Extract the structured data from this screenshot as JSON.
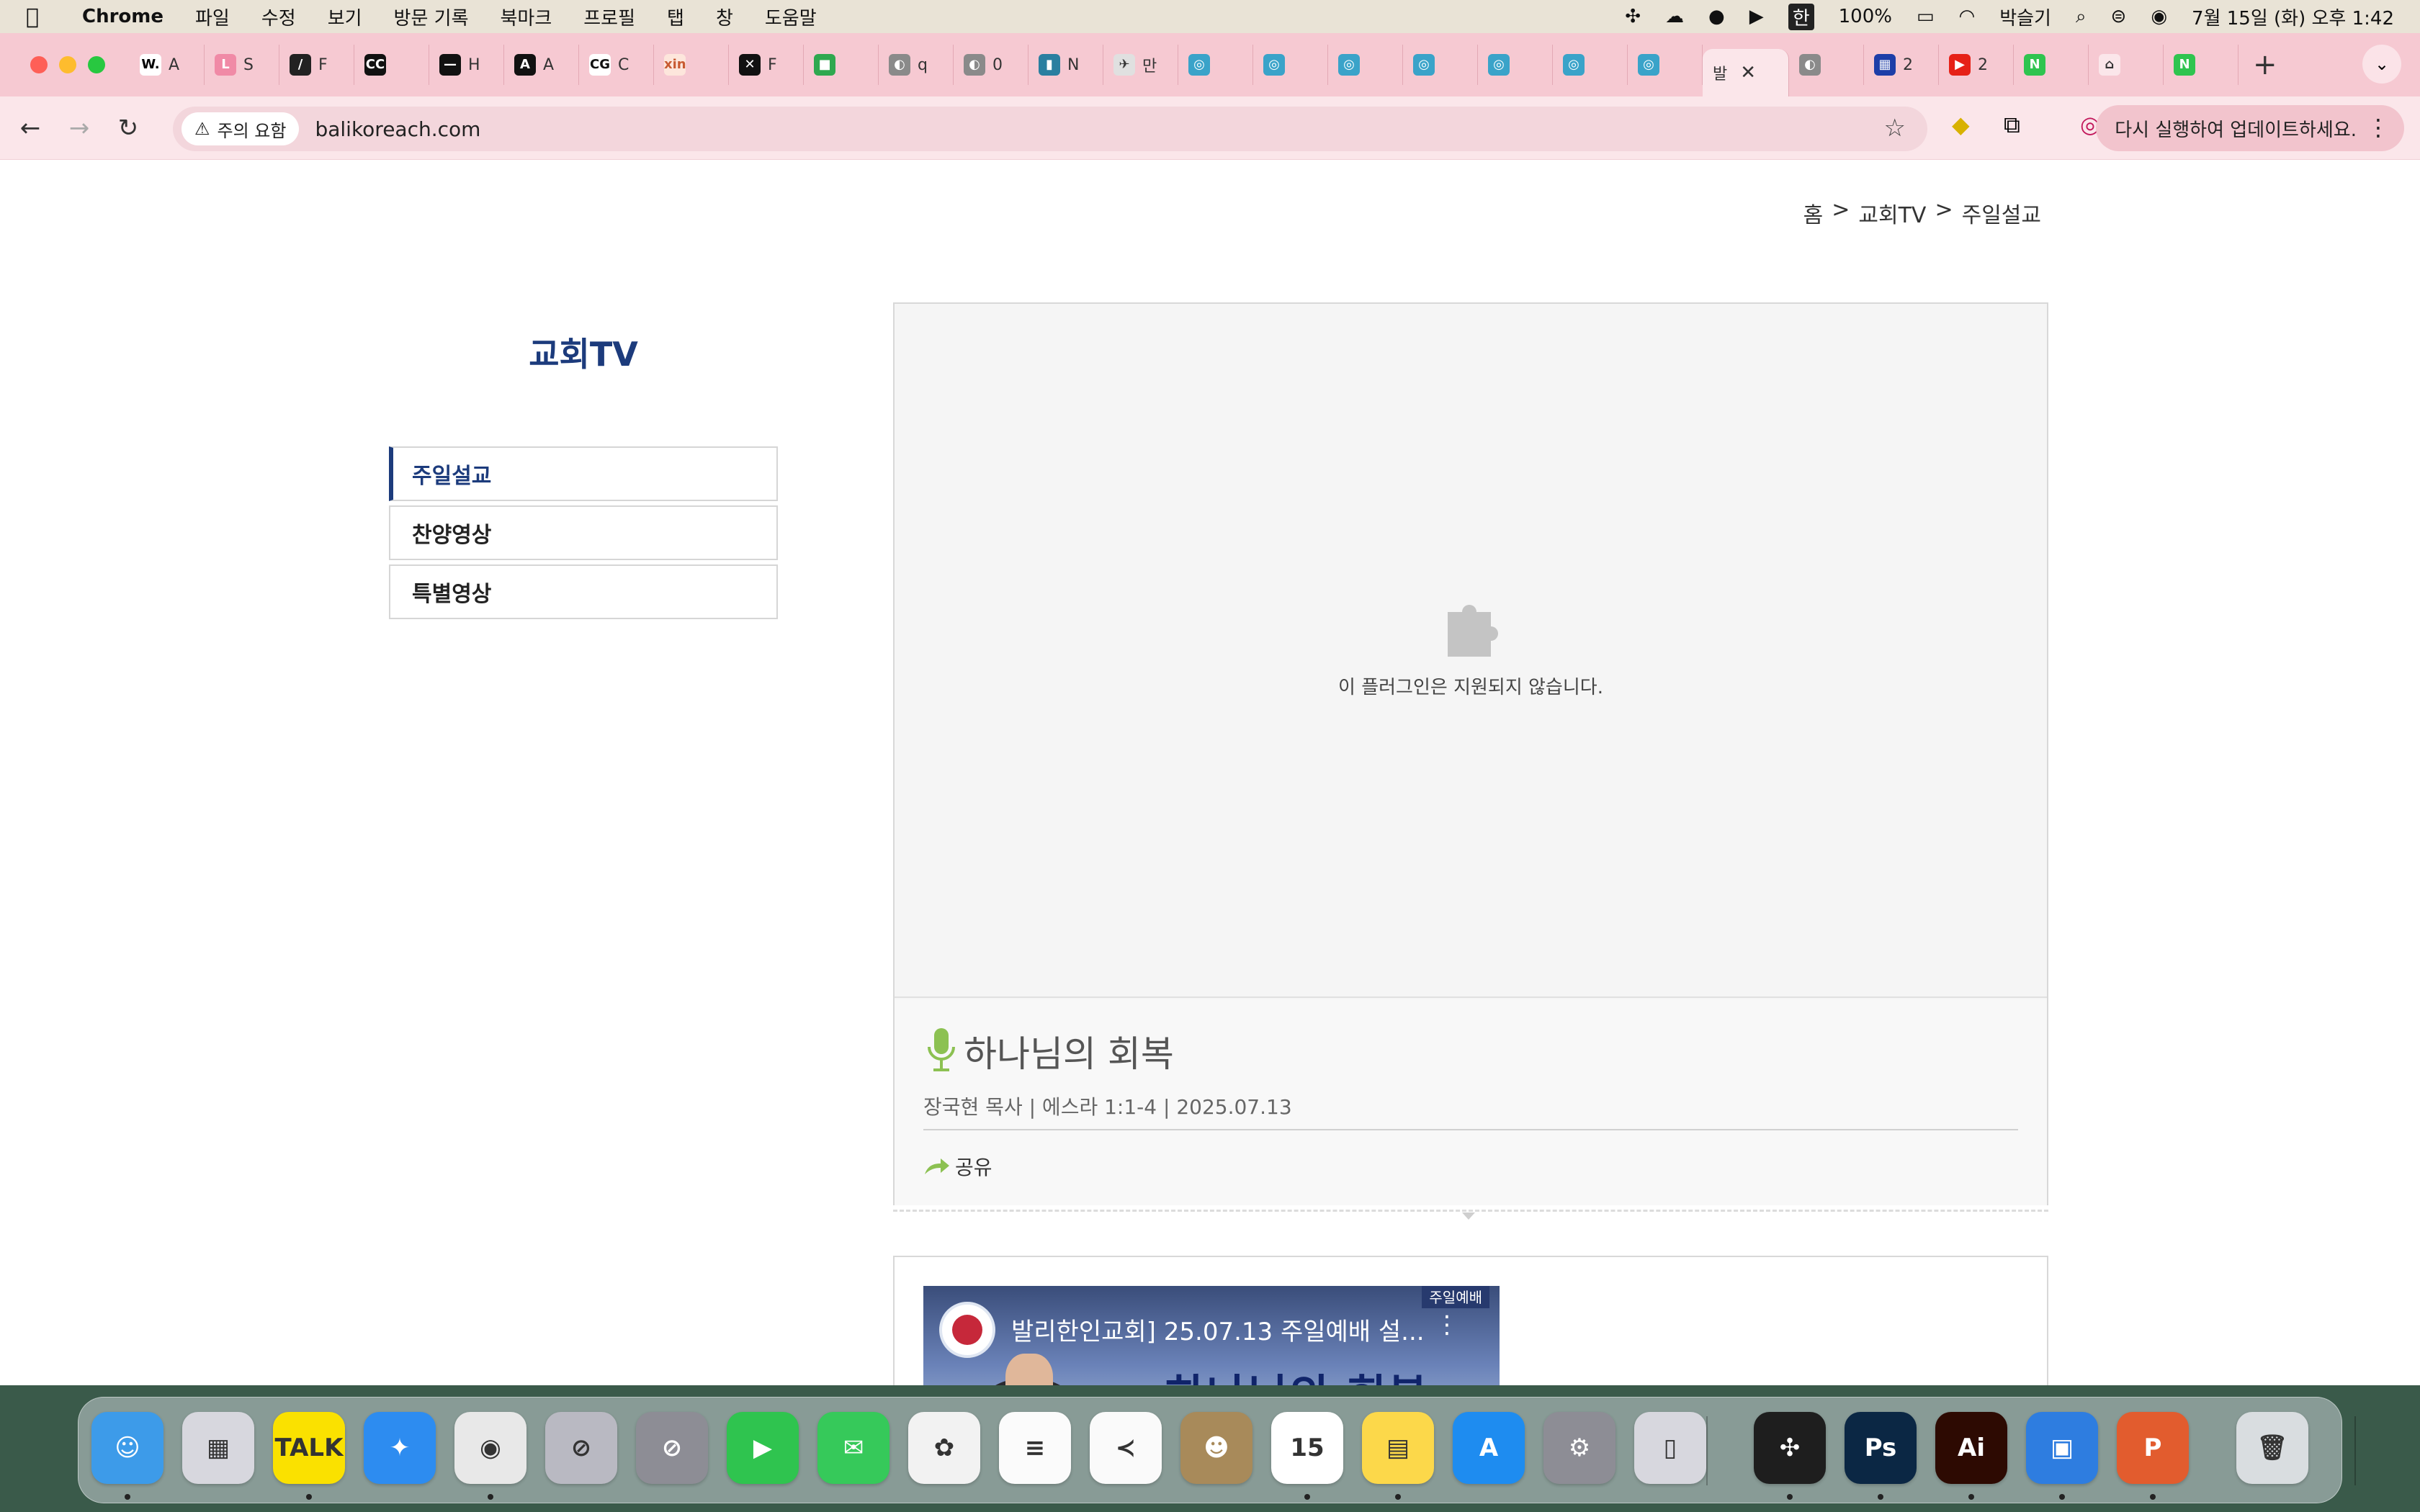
{
  "menubar": {
    "app_name": "Chrome",
    "menus": [
      "파일",
      "수정",
      "보기",
      "방문 기록",
      "북마크",
      "프로필",
      "탭",
      "창",
      "도움말"
    ],
    "battery": "100%",
    "input_lang": "한",
    "user": "박슬기",
    "datetime": "7월 15일 (화) 오후 1:42"
  },
  "tabs": [
    {
      "fav": "W.",
      "label": "A",
      "color": "#ffffff",
      "fg": "#000000"
    },
    {
      "fav": "L",
      "label": "S",
      "color": "#f08aa6",
      "fg": "#ffffff"
    },
    {
      "fav": "/",
      "label": "F",
      "color": "#222222",
      "fg": "#ffffff"
    },
    {
      "fav": "CC",
      "label": "",
      "color": "#111111",
      "fg": "#ffffff"
    },
    {
      "fav": "—",
      "label": "H",
      "color": "#111111",
      "fg": "#ffffff"
    },
    {
      "fav": "A",
      "label": "A",
      "color": "#111111",
      "fg": "#ffffff"
    },
    {
      "fav": "CG",
      "label": "C",
      "color": "#ffffff",
      "fg": "#111111"
    },
    {
      "fav": "xin",
      "label": "",
      "color": "#fde6dc",
      "fg": "#c85a32"
    },
    {
      "fav": "✕",
      "label": "F",
      "color": "#111111",
      "fg": "#ffffff"
    },
    {
      "fav": "■",
      "label": "",
      "color": "#2fa84f",
      "fg": "#ffffff"
    },
    {
      "fav": "◐",
      "label": "q",
      "color": "#8a8a8a",
      "fg": "#ffffff"
    },
    {
      "fav": "◐",
      "label": "0",
      "color": "#8a8a8a",
      "fg": "#ffffff"
    },
    {
      "fav": "▮",
      "label": "N",
      "color": "#2a7fa0",
      "fg": "#ffffff"
    },
    {
      "fav": "✈",
      "label": "만",
      "color": "#e0e0e0",
      "fg": "#333333"
    },
    {
      "fav": "◎",
      "label": "",
      "color": "#3aa3c9",
      "fg": "#ffffff"
    },
    {
      "fav": "◎",
      "label": "",
      "color": "#3aa3c9",
      "fg": "#ffffff"
    },
    {
      "fav": "◎",
      "label": "",
      "color": "#3aa3c9",
      "fg": "#ffffff"
    },
    {
      "fav": "◎",
      "label": "",
      "color": "#3aa3c9",
      "fg": "#ffffff"
    },
    {
      "fav": "◎",
      "label": "",
      "color": "#3aa3c9",
      "fg": "#ffffff"
    },
    {
      "fav": "◎",
      "label": "",
      "color": "#3aa3c9",
      "fg": "#ffffff"
    },
    {
      "fav": "◎",
      "label": "",
      "color": "#3aa3c9",
      "fg": "#ffffff"
    },
    {
      "fav": "",
      "label": "발",
      "color": "#fbe6ea",
      "fg": "#333333",
      "active": true
    },
    {
      "fav": "◐",
      "label": "",
      "color": "#8a8a8a",
      "fg": "#ffffff"
    },
    {
      "fav": "▦",
      "label": "2",
      "color": "#1d3ea8",
      "fg": "#ffffff"
    },
    {
      "fav": "▶",
      "label": "2",
      "color": "#e62117",
      "fg": "#ffffff"
    },
    {
      "fav": "N",
      "label": "",
      "color": "#2fc44f",
      "fg": "#ffffff"
    },
    {
      "fav": "⌂",
      "label": "",
      "color": "#fbe6ea",
      "fg": "#333333"
    },
    {
      "fav": "N",
      "label": "",
      "color": "#2fc44f",
      "fg": "#ffffff"
    }
  ],
  "toolbar": {
    "security_label": "주의 요함",
    "url": "balikoreach.com",
    "update_label": "다시 실행하여 업데이트하세요."
  },
  "breadcrumb": [
    "홈",
    "교회TV",
    "주일설교"
  ],
  "breadcrumb_sep": ">",
  "sidebar": {
    "title": "교회TV",
    "items": [
      "주일설교",
      "찬양영상",
      "특별영상"
    ]
  },
  "player": {
    "plugin_message": "이 플러그인은 지원되지 않습니다.",
    "sermon_title": "하나님의 회복",
    "sermon_meta": "장국현 목사 | 에스라 1:1-4 | 2025.07.13",
    "share_label": "공유"
  },
  "video": {
    "title": "발리한인교회] 25.07.13 주일예배 설...",
    "overlay_text": "하나님의 회복",
    "corner_tag": "주일예배"
  },
  "colors": {
    "accent": "#1c3b7c",
    "tabstrip": "#f6c9d2",
    "mic_green": "#8cc152"
  },
  "dock": {
    "items": [
      {
        "name": "finder",
        "label": "☺",
        "color": "#3d9be9"
      },
      {
        "name": "launchpad",
        "label": "▦",
        "color": "#d7d7de"
      },
      {
        "name": "kakaotalk",
        "label": "TALK",
        "color": "#fae100"
      },
      {
        "name": "safari",
        "label": "✦",
        "color": "#2d8cf0"
      },
      {
        "name": "chrome",
        "label": "◉",
        "color": "#e8e8e8"
      },
      {
        "name": "claquette",
        "label": "⊘",
        "color": "#b9b9c2"
      },
      {
        "name": "prohibit",
        "label": "⊘",
        "color": "#8d8d95"
      },
      {
        "name": "facetime",
        "label": "▶",
        "color": "#2fc44f"
      },
      {
        "name": "messages",
        "label": "✉",
        "color": "#36c95a"
      },
      {
        "name": "photos",
        "label": "✿",
        "color": "#f2f2f2"
      },
      {
        "name": "reminders",
        "label": "≡",
        "color": "#fbfbfb"
      },
      {
        "name": "vscode",
        "label": "≺",
        "color": "#fafafa"
      },
      {
        "name": "contacts",
        "label": "☻",
        "color": "#a88a5a"
      },
      {
        "name": "calendar",
        "label": "15",
        "color": "#ffffff"
      },
      {
        "name": "notes",
        "label": "▤",
        "color": "#fcd84a"
      },
      {
        "name": "appstore",
        "label": "A",
        "color": "#1e8cf0"
      },
      {
        "name": "settings",
        "label": "⚙",
        "color": "#8d8d95"
      },
      {
        "name": "iphone-mirroring",
        "label": "▯",
        "color": "#d7d7de"
      },
      {
        "name": "figma",
        "label": "✣",
        "color": "#1e1e1e"
      },
      {
        "name": "photoshop",
        "label": "Ps",
        "color": "#0b2744"
      },
      {
        "name": "illustrator",
        "label": "Ai",
        "color": "#2d0a02"
      },
      {
        "name": "toolbox",
        "label": "▣",
        "color": "#2e7de0"
      },
      {
        "name": "powerpoint",
        "label": "P",
        "color": "#e25c2e"
      },
      {
        "name": "trash",
        "label": "🗑",
        "color": "#d9dde0"
      }
    ]
  }
}
